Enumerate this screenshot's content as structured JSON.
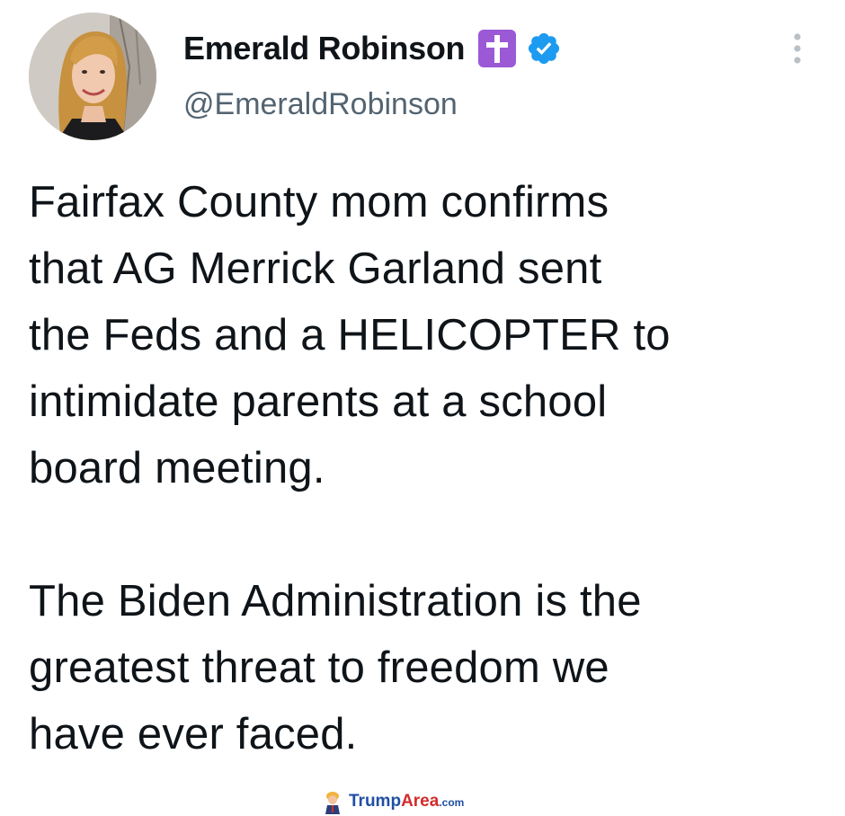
{
  "author": {
    "display_name": "Emerald Robinson",
    "handle": "@EmeraldRobinson",
    "name_emoji_icon": "latin-cross-icon",
    "verified_icon": "verified-badge-icon",
    "avatar": "avatar-photo"
  },
  "menu": {
    "icon": "more-vertical-icon"
  },
  "tweet": {
    "paragraph_1_lines": [
      "Fairfax County mom confirms",
      "that AG Merrick Garland sent",
      "the Feds and a HELICOPTER to",
      "intimidate parents at a school",
      "board meeting."
    ],
    "paragraph_2_lines": [
      "The Biden Administration is the",
      "greatest threat to freedom we",
      "have ever faced."
    ]
  },
  "watermark": {
    "brand_part_1": "Trump",
    "brand_part_2": "Area",
    "brand_part_3": ".com"
  },
  "colors": {
    "text": "#0f1419",
    "secondary_text": "#536471",
    "verified_blue": "#1d9bf0",
    "cross_purple": "#9b59d6"
  }
}
